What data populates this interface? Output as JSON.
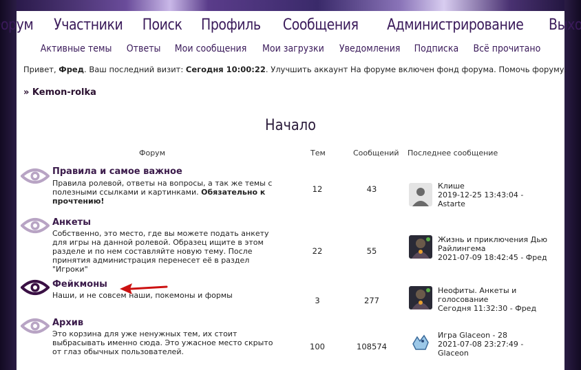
{
  "main_nav": [
    "Форум",
    "Участники",
    "Поиск",
    "Профиль",
    "Сообщения",
    "Администрирование",
    "Выход"
  ],
  "sub_nav": [
    "Активные темы",
    "Ответы",
    "Мои сообщения",
    "Мои загрузки",
    "Уведомления",
    "Подписка",
    "Всё прочитано"
  ],
  "userbar": {
    "greeting": "Привет,",
    "user": "Фред",
    "last_visit_label": ". Ваш последний визит:",
    "last_visit": "Сегодня 10:00:22",
    "upgrade": ". Улучшить аккаунт",
    "fund": "На форуме включен фонд форума.",
    "help": "Помочь форуму."
  },
  "breadcrumb": "» Kemon-rolka",
  "section_title": "Начало",
  "table_headers": {
    "forum": "Форум",
    "topics": "Тем",
    "posts": "Сообщений",
    "last": "Последнее сообщение"
  },
  "forums": [
    {
      "name": "Правила и самое важное",
      "desc": "Правила ролевой, ответы на вопросы, а так же темы с полезными ссылками и картинками.",
      "desc_bold": "Обязательно к прочтению!",
      "topics": "12",
      "posts": "43",
      "last_title": "Клише",
      "last_date": "2019-12-25 13:43:04 -",
      "last_user": "Astarte",
      "avatar": "default-avatar-icon"
    },
    {
      "name": "Анкеты",
      "desc": "Собственно, это место, где вы можете подать анкету для игры на данной ролевой. Образец ищите в этом разделе и по нем составляйте новую тему. После принятия администрация перенесет её в раздел \"Игроки\"",
      "desc_bold": "",
      "topics": "22",
      "posts": "55",
      "last_title": "Жизнь и приключения Дью Райлингема",
      "last_date": "2021-07-09 18:42:45 - Фред",
      "last_user": "",
      "avatar": "character-avatar"
    },
    {
      "name": "Фейкмоны",
      "desc": "Наши, и не совсем наши, покемоны и формы",
      "desc_bold": "",
      "topics": "3",
      "posts": "277",
      "last_title": "Неофиты. Анкеты и голосование",
      "last_date": "Сегодня 11:32:30 - Фред",
      "last_user": "",
      "avatar": "character-avatar"
    },
    {
      "name": "Архив",
      "desc": "Это корзина для уже ненужных тем, их стоит выбрасывать именно сюда. Это ужасное место скрыто от глаз обычных пользователей.",
      "desc_bold": "",
      "topics": "100",
      "posts": "108574",
      "last_title": "Игра Glaceon - 28",
      "last_date": "2021-07-08 23:27:49 -",
      "last_user": "Glaceon",
      "avatar": "glaceon-avatar"
    }
  ],
  "colors": {
    "accent": "#3a1a5a",
    "eye_read": "#b8a4c4",
    "eye_unread": "#3a1044",
    "arrow": "#cc1111"
  }
}
